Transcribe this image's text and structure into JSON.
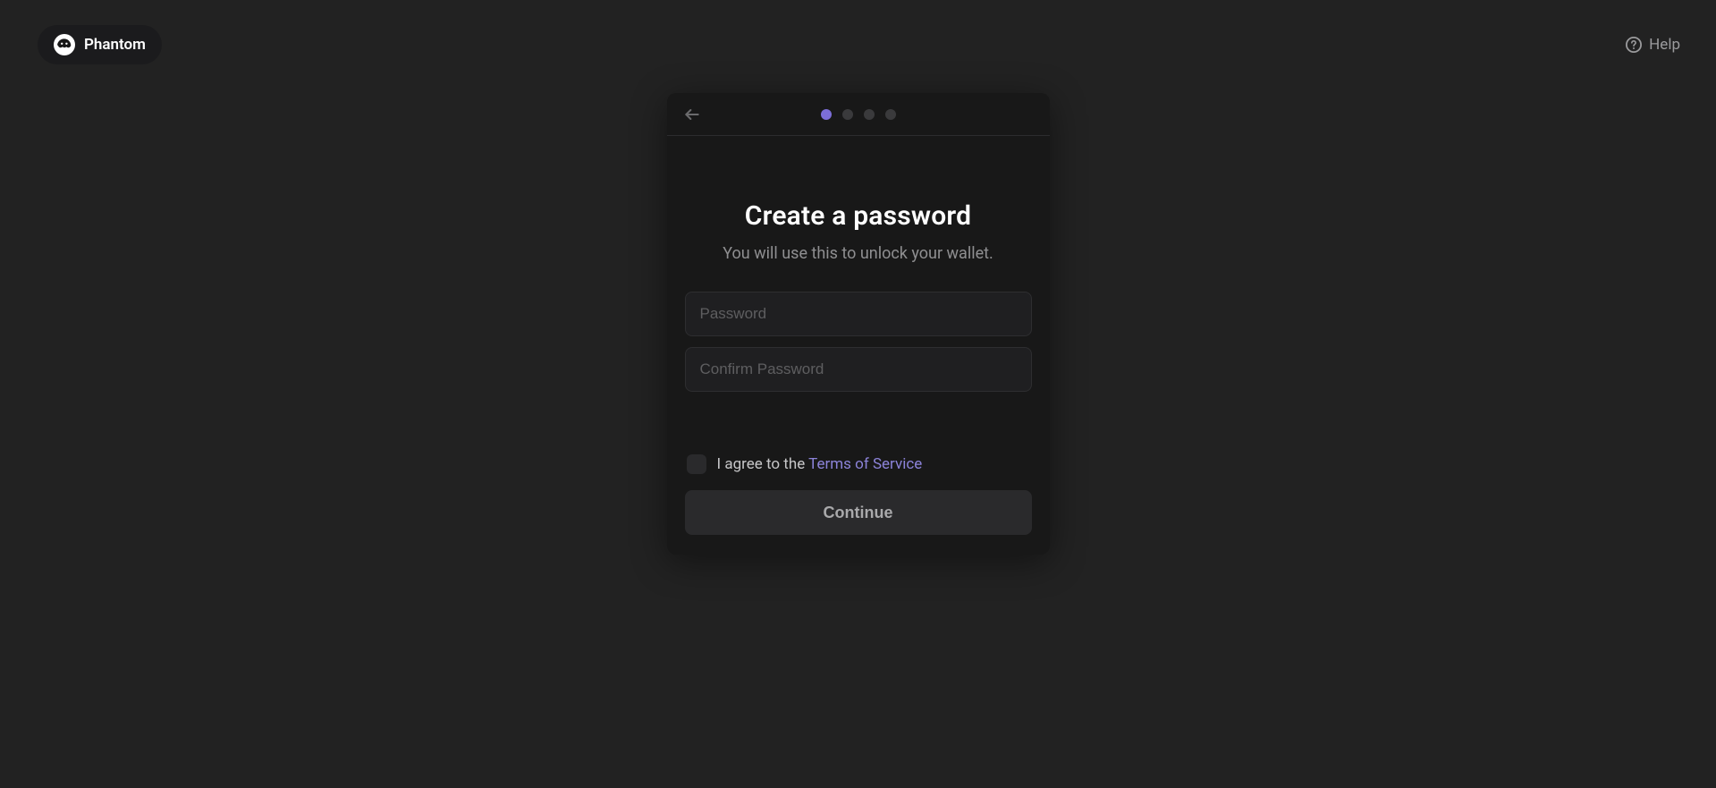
{
  "brand": {
    "name": "Phantom"
  },
  "help": {
    "label": "Help"
  },
  "progress": {
    "total_steps": 4,
    "active_step": 1
  },
  "title": "Create a password",
  "subtitle": "You will use this to unlock your wallet.",
  "fields": {
    "password_placeholder": "Password",
    "confirm_placeholder": "Confirm Password"
  },
  "tos": {
    "prefix": "I agree to the ",
    "link_text": "Terms of Service",
    "checked": false
  },
  "continue_label": "Continue"
}
